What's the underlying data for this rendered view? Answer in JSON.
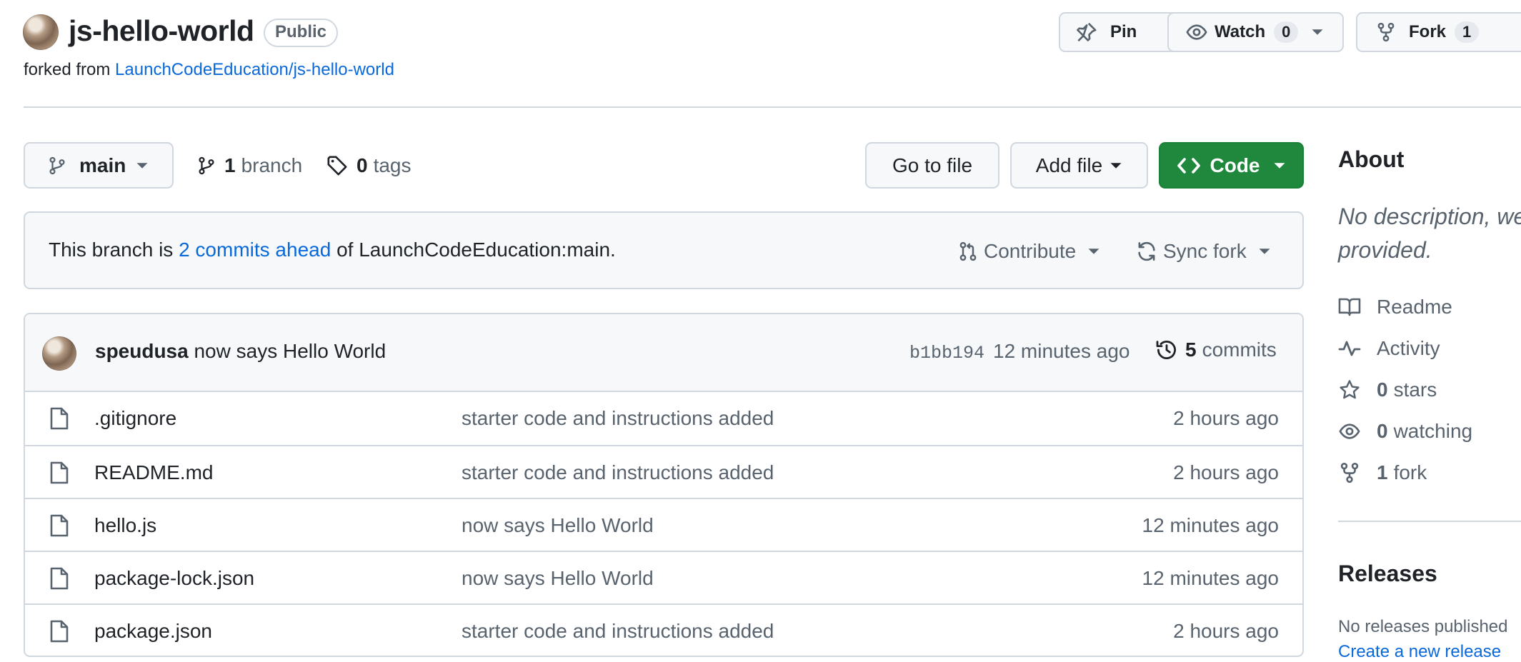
{
  "repo": {
    "name": "js-hello-world",
    "visibility": "Public",
    "forked_prefix": "forked from",
    "forked_link": "LaunchCodeEducation/js-hello-world"
  },
  "header_actions": {
    "pin": "Pin",
    "watch": "Watch",
    "watch_count": "0",
    "fork": "Fork",
    "fork_count": "1"
  },
  "toolbar": {
    "branch": "main",
    "branches_count": "1",
    "branches_label": "branch",
    "tags_count": "0",
    "tags_label": "tags",
    "go_to_file": "Go to file",
    "add_file": "Add file",
    "code": "Code"
  },
  "branch_status": {
    "prefix": "This branch is",
    "link": "2 commits ahead",
    "suffix": "of LaunchCodeEducation:main.",
    "contribute": "Contribute",
    "sync_fork": "Sync fork"
  },
  "latest_commit": {
    "author": "speudusa",
    "message": "now says Hello World",
    "sha": "b1bb194",
    "time": "12 minutes ago",
    "commits_count": "5",
    "commits_label": "commits"
  },
  "files": [
    {
      "name": ".gitignore",
      "message": "starter code and instructions added",
      "time": "2 hours ago"
    },
    {
      "name": "README.md",
      "message": "starter code and instructions added",
      "time": "2 hours ago"
    },
    {
      "name": "hello.js",
      "message": "now says Hello World",
      "time": "12 minutes ago"
    },
    {
      "name": "package-lock.json",
      "message": "now says Hello World",
      "time": "12 minutes ago"
    },
    {
      "name": "package.json",
      "message": "starter code and instructions added",
      "time": "2 hours ago"
    }
  ],
  "about": {
    "title": "About",
    "description_line1": "No description, we",
    "description_line2": "provided.",
    "readme": "Readme",
    "activity": "Activity",
    "stars_count": "0",
    "stars_label": "stars",
    "watching_count": "0",
    "watching_label": "watching",
    "forks_count": "1",
    "forks_label": "fork"
  },
  "releases": {
    "title": "Releases",
    "empty": "No releases published",
    "create": "Create a new release"
  },
  "colors": {
    "accent_link": "#0969da",
    "code_button": "#1f883d",
    "border": "#d0d7de",
    "muted_text": "#59636e"
  }
}
